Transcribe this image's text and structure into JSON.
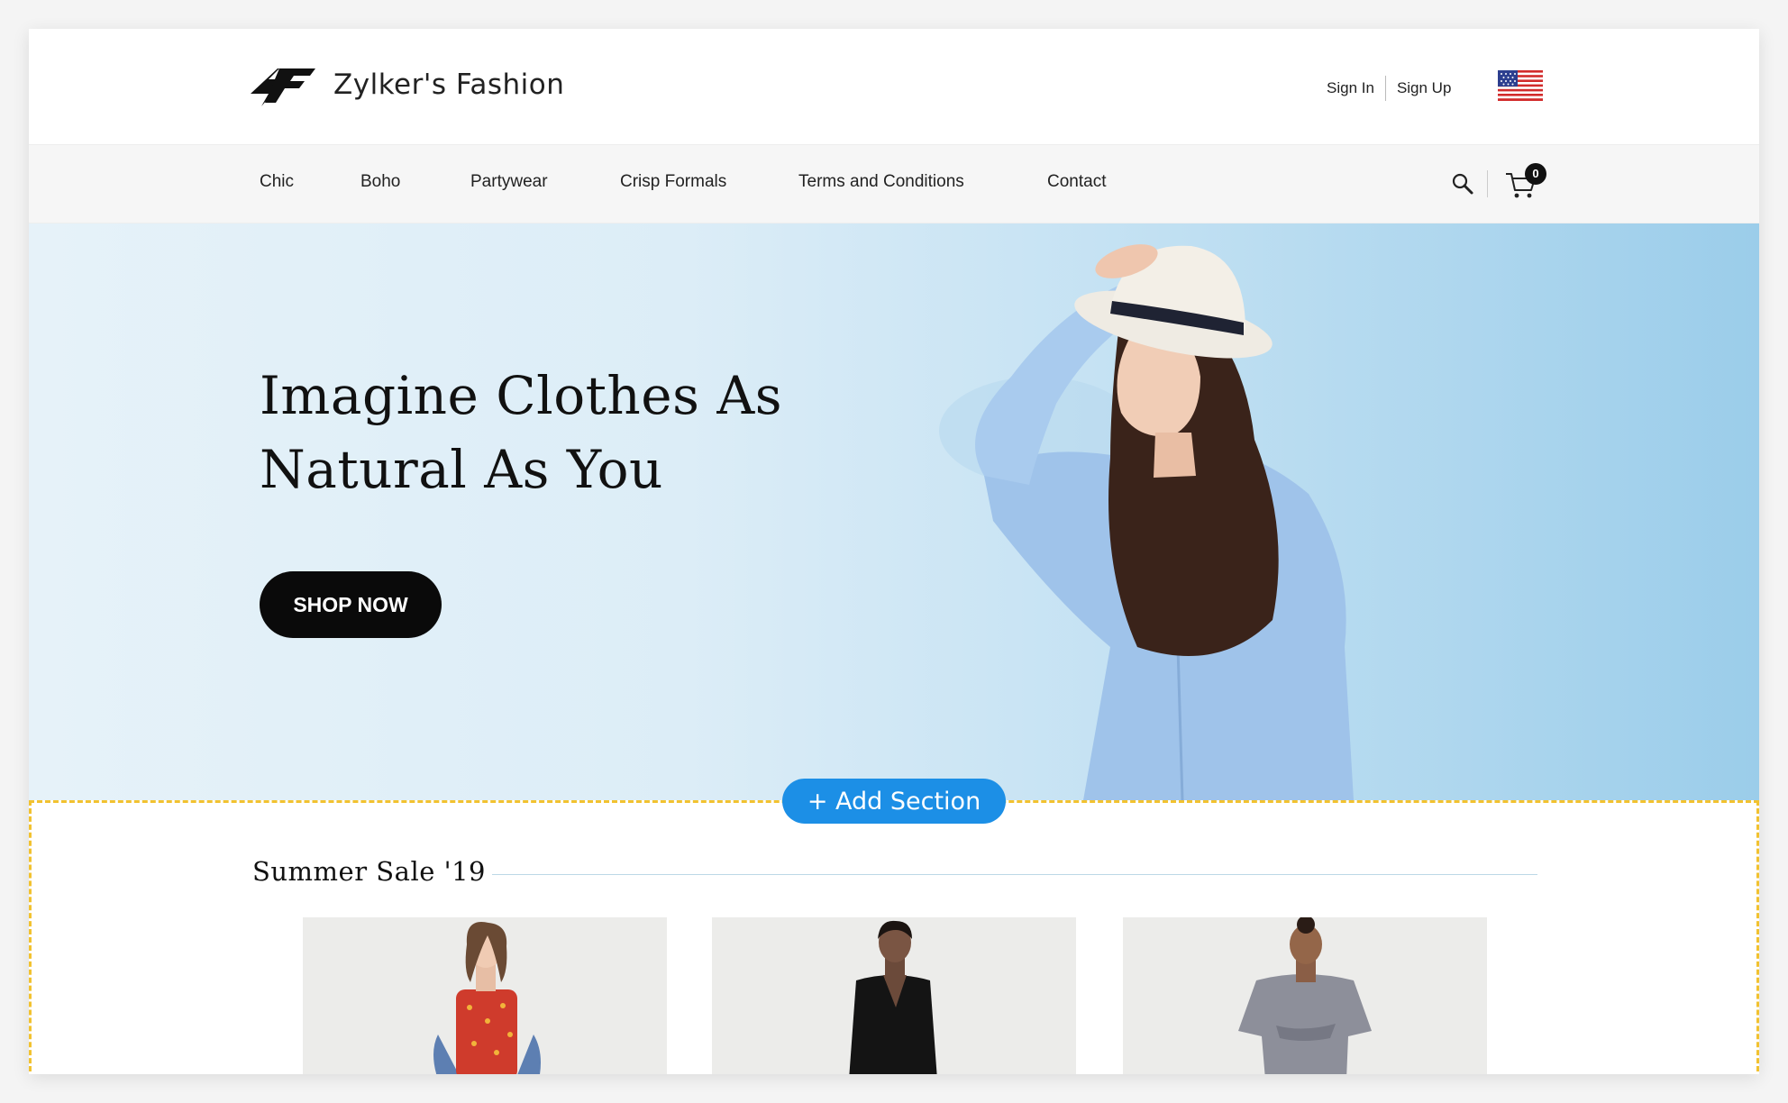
{
  "header": {
    "brand": "Zylker's Fashion",
    "sign_in": "Sign In",
    "sign_up": "Sign Up"
  },
  "nav": {
    "items": [
      "Chic",
      "Boho",
      "Partywear",
      "Crisp Formals",
      "Terms and Conditions",
      "Contact"
    ],
    "cart_count": "0"
  },
  "hero": {
    "title_line1": "Imagine Clothes As",
    "title_line2": "Natural As You",
    "cta": "SHOP NOW"
  },
  "editor": {
    "add_section": "+ Add Section"
  },
  "sale": {
    "title": "Summer Sale '19"
  },
  "colors": {
    "accent_blue": "#1c8fe6",
    "dashed_outline": "#f2c230",
    "button_dark": "#0a0a0a"
  }
}
